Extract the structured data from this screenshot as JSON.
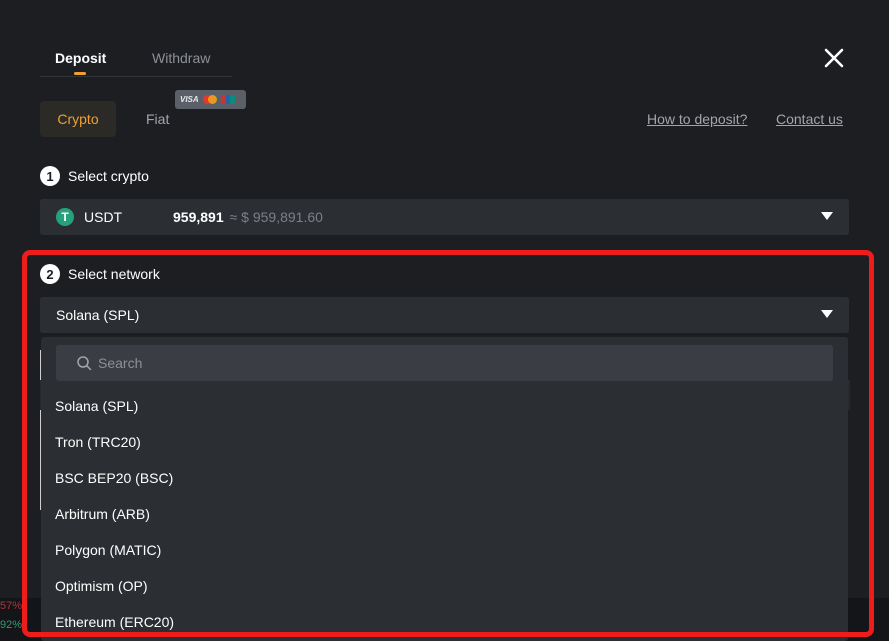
{
  "tabs": {
    "deposit": "Deposit",
    "withdraw": "Withdraw"
  },
  "subtabs": {
    "crypto": "Crypto",
    "fiat": "Fiat"
  },
  "card_badge": {
    "visa": "VISA"
  },
  "links": {
    "how_to_deposit": "How to deposit?",
    "contact_us": "Contact us"
  },
  "step1": {
    "number": "1",
    "label": "Select crypto"
  },
  "crypto_select": {
    "icon_letter": "T",
    "coin": "USDT",
    "balance": "959,891",
    "approx": "≈ $ 959,891.60"
  },
  "step2": {
    "number": "2",
    "label": "Select network"
  },
  "network_select": {
    "selected": "Solana (SPL)"
  },
  "search": {
    "placeholder": "Search"
  },
  "networks": [
    "Solana (SPL)",
    "Tron (TRC20)",
    "BSC BEP20 (BSC)",
    "Arbitrum (ARB)",
    "Polygon (MATIC)",
    "Optimism (OP)",
    "Ethereum (ERC20)"
  ],
  "background_tickers": {
    "a": "57%",
    "b": "92%"
  },
  "colors": {
    "accent": "#f0a030",
    "highlight": "#ef1c1c",
    "usdt": "#26a17b"
  }
}
